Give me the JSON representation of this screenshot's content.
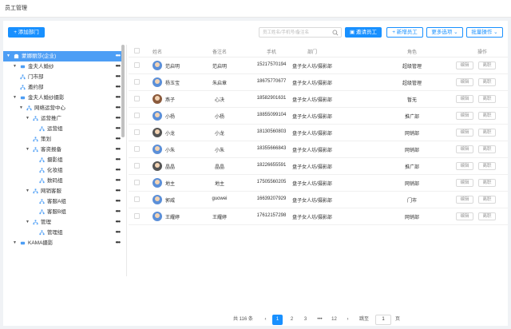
{
  "header": {
    "title": "员工管理"
  },
  "toolbar": {
    "add_dept": "+ 添加部门",
    "search_placeholder": "员工姓名/手机号/备注名",
    "invite": "邀请员工",
    "new_employee": "+ 新增员工",
    "more": "更多选项",
    "batch": "批量操作"
  },
  "tree": [
    {
      "label": "蒙娜丽莎(企业)",
      "icon": "building-icon"
    },
    {
      "label": "金夫人婚纱",
      "icon": "org-icon"
    },
    {
      "label": "门市部",
      "icon": "dept-icon"
    },
    {
      "label": "邀约部",
      "icon": "dept-icon"
    },
    {
      "label": "金夫人婚纱摄影",
      "icon": "org-icon"
    },
    {
      "label": "网络运营中心",
      "icon": "dept-icon"
    },
    {
      "label": "运营推广",
      "icon": "dept-icon"
    },
    {
      "label": "运营组",
      "icon": "dept-icon"
    },
    {
      "label": "策划",
      "icon": "dept-icon"
    },
    {
      "label": "客资报备",
      "icon": "dept-icon"
    },
    {
      "label": "摄影组",
      "icon": "dept-icon"
    },
    {
      "label": "化妆组",
      "icon": "dept-icon"
    },
    {
      "label": "数码组",
      "icon": "dept-icon"
    },
    {
      "label": "网销客服",
      "icon": "dept-icon"
    },
    {
      "label": "客服A组",
      "icon": "dept-icon"
    },
    {
      "label": "客服B组",
      "icon": "dept-icon"
    },
    {
      "label": "管理",
      "icon": "dept-icon"
    },
    {
      "label": "管理组",
      "icon": "dept-icon"
    },
    {
      "label": "KAMA摄影",
      "icon": "org-icon"
    }
  ],
  "tree_more": "•••",
  "columns": {
    "name": "姓名",
    "remark": "备注名",
    "phone": "手机",
    "dept": "部门",
    "role": "角色",
    "ops": "操作"
  },
  "rows": [
    {
      "name": "范启明",
      "remark": "范启明",
      "phone": "15217570194",
      "dept": "盘子女人坊/摄影部",
      "role": "超级管理"
    },
    {
      "name": "杨玉宝",
      "remark": "朱启章",
      "phone": "18675770677",
      "dept": "盘子女人坊/摄影部",
      "role": "超级管理"
    },
    {
      "name": "燕子",
      "remark": "心决",
      "phone": "18582901631",
      "dept": "盘子女人坊/摄影部",
      "role": "暂无"
    },
    {
      "name": "小杨",
      "remark": "小杨",
      "phone": "18855099104",
      "dept": "盘子女人坊/摄影部",
      "role": "推广部"
    },
    {
      "name": "小龙",
      "remark": "小龙",
      "phone": "18130560803",
      "dept": "盘子女人坊/摄影部",
      "role": "网销部"
    },
    {
      "name": "小朱",
      "remark": "小朱",
      "phone": "18355666843",
      "dept": "盘子女人坊/摄影部",
      "role": "网销部"
    },
    {
      "name": "晶晶",
      "remark": "晶晶",
      "phone": "18226655591",
      "dept": "盘子女人坊/摄影部",
      "role": "推广部"
    },
    {
      "name": "地主",
      "remark": "地主",
      "phone": "17505560205",
      "dept": "盘子女人坊/摄影部",
      "role": "网销部"
    },
    {
      "name": "郭威",
      "remark": "guowei",
      "phone": "16639207929",
      "dept": "盘子女人坊/摄影部",
      "role": "门市"
    },
    {
      "name": "王耀婷",
      "remark": "王耀婷",
      "phone": "17612157298",
      "dept": "盘子女人坊/摄影部",
      "role": "网销部"
    }
  ],
  "row_actions": {
    "edit": "编辑",
    "leave": "离职"
  },
  "pagination": {
    "total": "共 116 条",
    "prev": "‹",
    "pages": [
      "1",
      "2",
      "3",
      "•••",
      "12"
    ],
    "next": "›",
    "jump_label": "跳至",
    "jump_value": "1",
    "page_unit": "页"
  }
}
